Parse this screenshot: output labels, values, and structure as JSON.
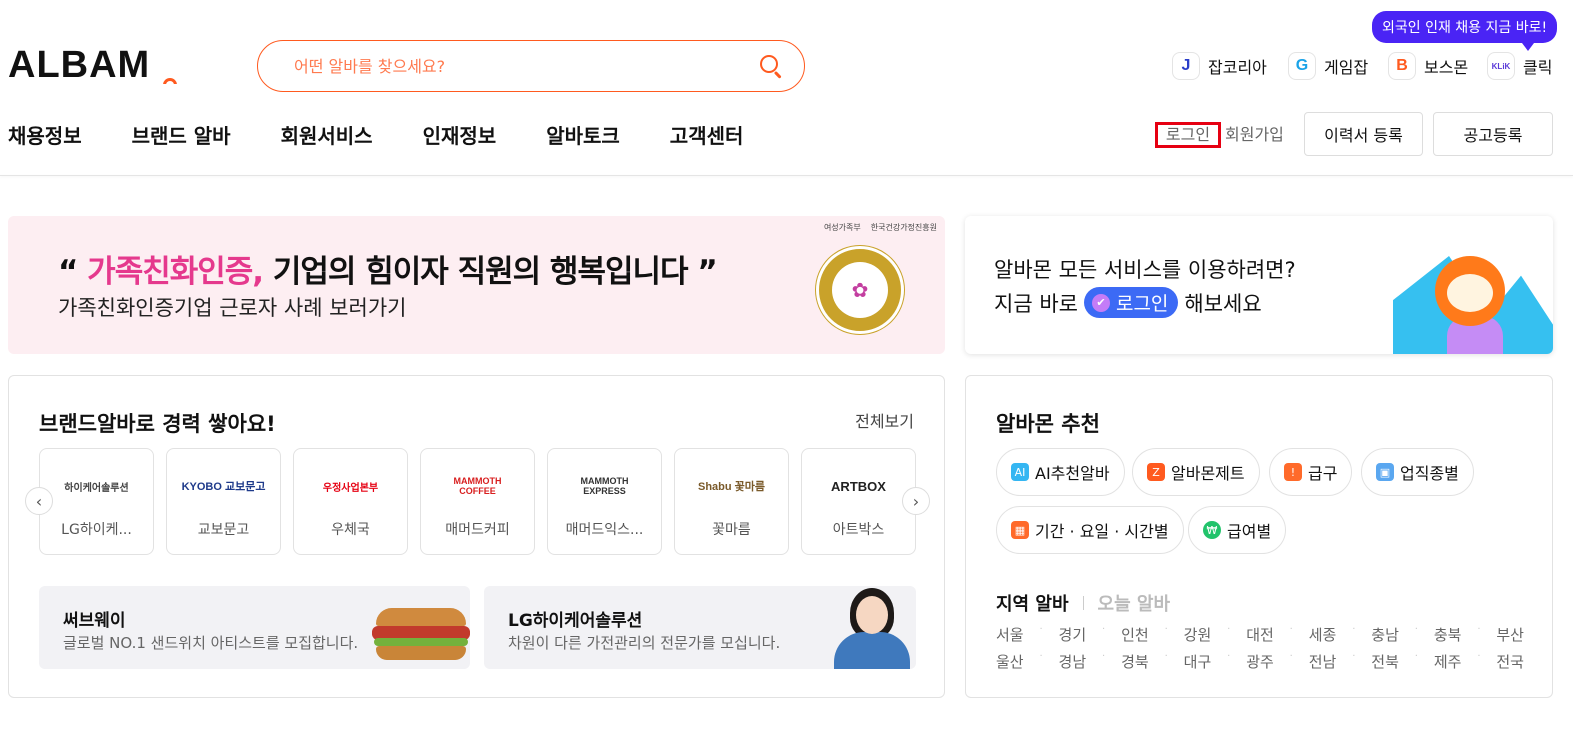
{
  "header": {
    "logo_text": "ALBAM",
    "search": {
      "placeholder": "어떤 알바를 찾으세요?"
    },
    "tooltip": "외국인 인재 채용 지금 바로!",
    "family_sites": [
      {
        "label": "잡코리아",
        "badge": "J",
        "color": "#2a3ec9"
      },
      {
        "label": "게임잡",
        "badge": "G",
        "color": "#1aa3e8"
      },
      {
        "label": "보스몬",
        "badge": "B",
        "color": "#ff5a1f"
      },
      {
        "label": "클릭",
        "badge": "KLiK",
        "color": "#5b3ad8"
      }
    ],
    "nav": [
      "채용정보",
      "브랜드 알바",
      "회원서비스",
      "인재정보",
      "알바토크",
      "고객센터"
    ],
    "login": "로그인",
    "join": "회원가입",
    "resume_button": "이력서 등록",
    "post_button": "공고등록"
  },
  "banner": {
    "open_quote": "“",
    "pink_text": "가족친화인증,",
    "headline_rest": "기업의 힘이자 직원의 행복입니다",
    "close_quote": "”",
    "subline": "가족친화인증기업 근로자 사례 보러가기",
    "org1": "여성가족부",
    "org2": "한국건강가정진흥원"
  },
  "login_box": {
    "line1": "알바몬 모든 서비스를 이용하려면?",
    "line2_prefix": "지금 바로",
    "pill": "로그인",
    "line2_suffix": "해보세요"
  },
  "brand_section": {
    "title": "브랜드알바로 경력 쌓아요!",
    "more": "전체보기",
    "brands": [
      {
        "logo": "하이케어솔루션",
        "name": "LG하이케..."
      },
      {
        "logo": "KYOBO 교보문고",
        "name": "교보문고"
      },
      {
        "logo": "우정사업본부",
        "name": "우체국"
      },
      {
        "logo": "MAMMOTH COFFEE",
        "name": "매머드커피"
      },
      {
        "logo": "MAMMOTH EXPRESS",
        "name": "매머드익스..."
      },
      {
        "logo": "Shabu 꽃마름",
        "name": "꽃마름"
      },
      {
        "logo": "ARTBOX",
        "name": "아트박스"
      }
    ],
    "promos": [
      {
        "title": "써브웨이",
        "desc": "글로벌 NO.1 샌드위치 아티스트를 모집합니다."
      },
      {
        "title": "LG하이케어솔루션",
        "desc": "차원이 다른 가전관리의 전문가를 모십니다."
      }
    ]
  },
  "recommend": {
    "title": "알바몬 추천",
    "chips": [
      {
        "label": "AI추천알바",
        "icon": "ai-icon",
        "color": "#35b6f2"
      },
      {
        "label": "알바몬제트",
        "icon": "zet-icon",
        "color": "#ff5a1f"
      },
      {
        "label": "급구",
        "icon": "siren-icon",
        "color": "#ff6a2a"
      },
      {
        "label": "업직종별",
        "icon": "briefcase-icon",
        "color": "#5aa7f0"
      },
      {
        "label": "기간 · 요일 · 시간별",
        "icon": "calendar-icon",
        "color": "#ff6a2a"
      },
      {
        "label": "급여별",
        "icon": "won-icon",
        "color": "#22c36b"
      }
    ],
    "tab_active": "지역 알바",
    "tab_inactive": "오늘 알바",
    "regions_row1": [
      "서울",
      "경기",
      "인천",
      "강원",
      "대전",
      "세종",
      "충남",
      "충북",
      "부산"
    ],
    "regions_row2": [
      "울산",
      "경남",
      "경북",
      "대구",
      "광주",
      "전남",
      "전북",
      "제주",
      "전국"
    ]
  }
}
